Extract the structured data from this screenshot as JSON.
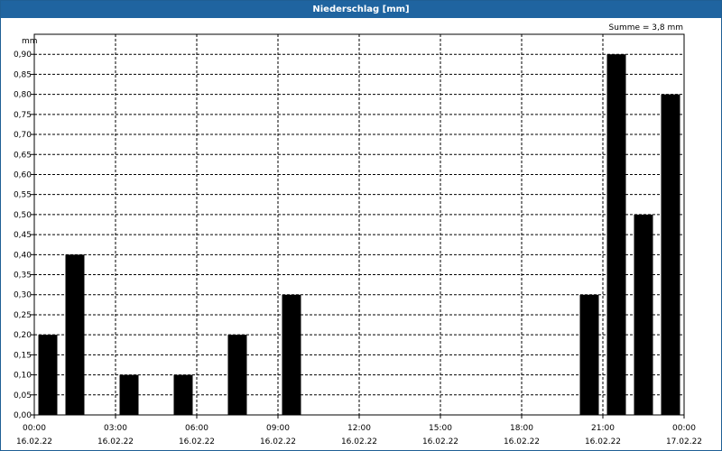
{
  "window": {
    "title": "Niederschlag [mm]"
  },
  "summary": "Summe = 3,8 mm",
  "chart_data": {
    "type": "bar",
    "title": "Niederschlag [mm]",
    "ylabel": "mm",
    "ylim": [
      0,
      0.95
    ],
    "yticks": [
      "0,00",
      "0,05",
      "0,10",
      "0,15",
      "0,20",
      "0,25",
      "0,30",
      "0,35",
      "0,40",
      "0,45",
      "0,50",
      "0,55",
      "0,60",
      "0,65",
      "0,70",
      "0,75",
      "0,80",
      "0,85",
      "0,90"
    ],
    "xticks": [
      {
        "time": "00:00",
        "date": "16.02.22"
      },
      {
        "time": "03:00",
        "date": "16.02.22"
      },
      {
        "time": "06:00",
        "date": "16.02.22"
      },
      {
        "time": "09:00",
        "date": "16.02.22"
      },
      {
        "time": "12:00",
        "date": "16.02.22"
      },
      {
        "time": "15:00",
        "date": "16.02.22"
      },
      {
        "time": "18:00",
        "date": "16.02.22"
      },
      {
        "time": "21:00",
        "date": "16.02.22"
      },
      {
        "time": "00:00",
        "date": "17.02.22"
      }
    ],
    "categories": [
      "00:00",
      "01:00",
      "02:00",
      "03:00",
      "04:00",
      "05:00",
      "06:00",
      "07:00",
      "08:00",
      "09:00",
      "10:00",
      "11:00",
      "12:00",
      "13:00",
      "14:00",
      "15:00",
      "16:00",
      "17:00",
      "18:00",
      "19:00",
      "20:00",
      "21:00",
      "22:00",
      "23:00"
    ],
    "values": [
      0.2,
      0.4,
      0,
      0.1,
      0,
      0.1,
      0,
      0.2,
      0,
      0.3,
      0,
      0,
      0,
      0,
      0,
      0,
      0,
      0,
      0,
      0,
      0.3,
      0.9,
      0.5,
      0.8
    ],
    "grid": true,
    "bar_color": "#000000"
  }
}
